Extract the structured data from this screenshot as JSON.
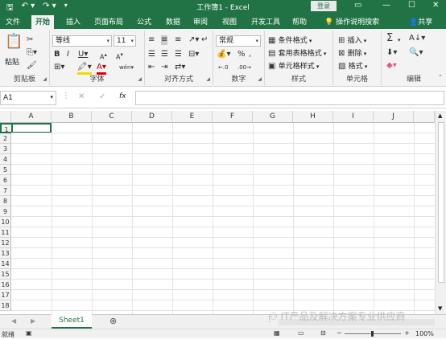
{
  "titlebar": {
    "title": "工作簿1 - Excel",
    "login": "登录",
    "save_icon": "save-icon",
    "undo_icon": "undo-icon",
    "redo_icon": "redo-icon"
  },
  "menu": {
    "tabs": [
      "文件",
      "开始",
      "插入",
      "页面布局",
      "公式",
      "数据",
      "审阅",
      "视图",
      "开发工具",
      "帮助"
    ],
    "active": "开始",
    "help_search": "操作说明搜索",
    "share": "共享"
  },
  "ribbon": {
    "clipboard": {
      "label": "剪贴板",
      "paste": "粘贴"
    },
    "font": {
      "label": "字体",
      "family": "等线",
      "size": "11"
    },
    "alignment": {
      "label": "对齐方式"
    },
    "number": {
      "label": "数字",
      "format": "常规",
      "percent": "%"
    },
    "styles": {
      "label": "样式",
      "conditional": "条件格式",
      "table": "套用表格格式",
      "cell_styles": "单元格样式"
    },
    "cells": {
      "label": "单元格",
      "insert": "插入",
      "delete": "删除",
      "format": "格式"
    },
    "editing": {
      "label": "编辑",
      "sum": "Σ"
    }
  },
  "formula_bar": {
    "name_box": "A1",
    "fx": "fx"
  },
  "grid": {
    "columns": [
      "A",
      "B",
      "C",
      "D",
      "E",
      "F",
      "G",
      "H",
      "I",
      "J"
    ],
    "rows": [
      "1",
      "2",
      "3",
      "4",
      "5",
      "6",
      "7",
      "8",
      "9",
      "10",
      "11",
      "12",
      "13",
      "14",
      "15",
      "16",
      "17",
      "18"
    ]
  },
  "sheets": {
    "tabs": [
      "Sheet1"
    ]
  },
  "status": {
    "ready": "就绪",
    "zoom": "100%"
  },
  "watermark": "IT产品及解决方案专业供应商"
}
